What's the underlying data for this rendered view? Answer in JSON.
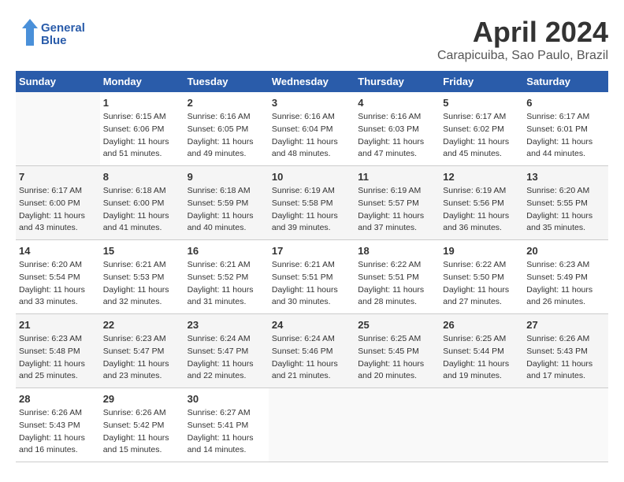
{
  "header": {
    "logo_line1": "General",
    "logo_line2": "Blue",
    "month_title": "April 2024",
    "location": "Carapicuiba, Sao Paulo, Brazil"
  },
  "weekdays": [
    "Sunday",
    "Monday",
    "Tuesday",
    "Wednesday",
    "Thursday",
    "Friday",
    "Saturday"
  ],
  "weeks": [
    [
      {
        "day": "",
        "info": ""
      },
      {
        "day": "1",
        "info": "Sunrise: 6:15 AM\nSunset: 6:06 PM\nDaylight: 11 hours\nand 51 minutes."
      },
      {
        "day": "2",
        "info": "Sunrise: 6:16 AM\nSunset: 6:05 PM\nDaylight: 11 hours\nand 49 minutes."
      },
      {
        "day": "3",
        "info": "Sunrise: 6:16 AM\nSunset: 6:04 PM\nDaylight: 11 hours\nand 48 minutes."
      },
      {
        "day": "4",
        "info": "Sunrise: 6:16 AM\nSunset: 6:03 PM\nDaylight: 11 hours\nand 47 minutes."
      },
      {
        "day": "5",
        "info": "Sunrise: 6:17 AM\nSunset: 6:02 PM\nDaylight: 11 hours\nand 45 minutes."
      },
      {
        "day": "6",
        "info": "Sunrise: 6:17 AM\nSunset: 6:01 PM\nDaylight: 11 hours\nand 44 minutes."
      }
    ],
    [
      {
        "day": "7",
        "info": "Sunrise: 6:17 AM\nSunset: 6:00 PM\nDaylight: 11 hours\nand 43 minutes."
      },
      {
        "day": "8",
        "info": "Sunrise: 6:18 AM\nSunset: 6:00 PM\nDaylight: 11 hours\nand 41 minutes."
      },
      {
        "day": "9",
        "info": "Sunrise: 6:18 AM\nSunset: 5:59 PM\nDaylight: 11 hours\nand 40 minutes."
      },
      {
        "day": "10",
        "info": "Sunrise: 6:19 AM\nSunset: 5:58 PM\nDaylight: 11 hours\nand 39 minutes."
      },
      {
        "day": "11",
        "info": "Sunrise: 6:19 AM\nSunset: 5:57 PM\nDaylight: 11 hours\nand 37 minutes."
      },
      {
        "day": "12",
        "info": "Sunrise: 6:19 AM\nSunset: 5:56 PM\nDaylight: 11 hours\nand 36 minutes."
      },
      {
        "day": "13",
        "info": "Sunrise: 6:20 AM\nSunset: 5:55 PM\nDaylight: 11 hours\nand 35 minutes."
      }
    ],
    [
      {
        "day": "14",
        "info": "Sunrise: 6:20 AM\nSunset: 5:54 PM\nDaylight: 11 hours\nand 33 minutes."
      },
      {
        "day": "15",
        "info": "Sunrise: 6:21 AM\nSunset: 5:53 PM\nDaylight: 11 hours\nand 32 minutes."
      },
      {
        "day": "16",
        "info": "Sunrise: 6:21 AM\nSunset: 5:52 PM\nDaylight: 11 hours\nand 31 minutes."
      },
      {
        "day": "17",
        "info": "Sunrise: 6:21 AM\nSunset: 5:51 PM\nDaylight: 11 hours\nand 30 minutes."
      },
      {
        "day": "18",
        "info": "Sunrise: 6:22 AM\nSunset: 5:51 PM\nDaylight: 11 hours\nand 28 minutes."
      },
      {
        "day": "19",
        "info": "Sunrise: 6:22 AM\nSunset: 5:50 PM\nDaylight: 11 hours\nand 27 minutes."
      },
      {
        "day": "20",
        "info": "Sunrise: 6:23 AM\nSunset: 5:49 PM\nDaylight: 11 hours\nand 26 minutes."
      }
    ],
    [
      {
        "day": "21",
        "info": "Sunrise: 6:23 AM\nSunset: 5:48 PM\nDaylight: 11 hours\nand 25 minutes."
      },
      {
        "day": "22",
        "info": "Sunrise: 6:23 AM\nSunset: 5:47 PM\nDaylight: 11 hours\nand 23 minutes."
      },
      {
        "day": "23",
        "info": "Sunrise: 6:24 AM\nSunset: 5:47 PM\nDaylight: 11 hours\nand 22 minutes."
      },
      {
        "day": "24",
        "info": "Sunrise: 6:24 AM\nSunset: 5:46 PM\nDaylight: 11 hours\nand 21 minutes."
      },
      {
        "day": "25",
        "info": "Sunrise: 6:25 AM\nSunset: 5:45 PM\nDaylight: 11 hours\nand 20 minutes."
      },
      {
        "day": "26",
        "info": "Sunrise: 6:25 AM\nSunset: 5:44 PM\nDaylight: 11 hours\nand 19 minutes."
      },
      {
        "day": "27",
        "info": "Sunrise: 6:26 AM\nSunset: 5:43 PM\nDaylight: 11 hours\nand 17 minutes."
      }
    ],
    [
      {
        "day": "28",
        "info": "Sunrise: 6:26 AM\nSunset: 5:43 PM\nDaylight: 11 hours\nand 16 minutes."
      },
      {
        "day": "29",
        "info": "Sunrise: 6:26 AM\nSunset: 5:42 PM\nDaylight: 11 hours\nand 15 minutes."
      },
      {
        "day": "30",
        "info": "Sunrise: 6:27 AM\nSunset: 5:41 PM\nDaylight: 11 hours\nand 14 minutes."
      },
      {
        "day": "",
        "info": ""
      },
      {
        "day": "",
        "info": ""
      },
      {
        "day": "",
        "info": ""
      },
      {
        "day": "",
        "info": ""
      }
    ]
  ]
}
